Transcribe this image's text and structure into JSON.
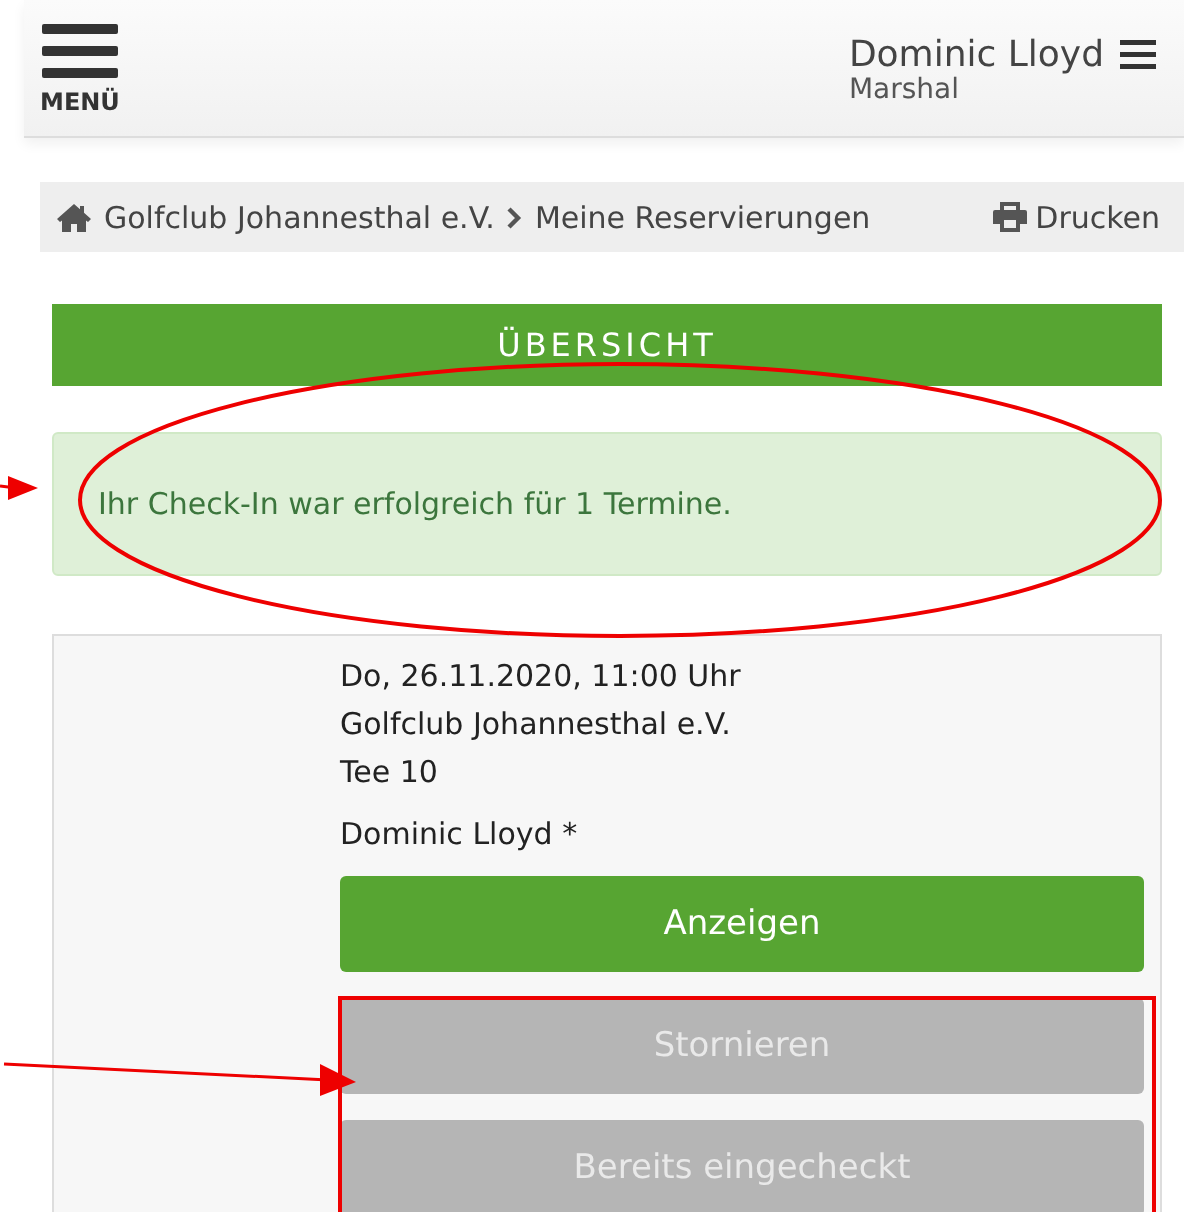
{
  "header": {
    "menu_label": "MENÜ",
    "user_name": "Dominic Lloyd",
    "user_role": "Marshal"
  },
  "breadcrumb": {
    "items": [
      "Golfclub Johannesthal e.V.",
      "Meine Reservierungen"
    ],
    "print_label": "Drucken"
  },
  "section_title": "ÜBERSICHT",
  "alert": {
    "text": "Ihr Check-In war erfolgreich für 1 Termine."
  },
  "reservation": {
    "lines": [
      "Do, 26.11.2020, 11:00 Uhr",
      "Golfclub Johannesthal e.V.",
      "Tee 10"
    ],
    "player": "Dominic Lloyd *",
    "buttons": [
      {
        "label": "Anzeigen",
        "disabled": false
      },
      {
        "label": "Stornieren",
        "disabled": true
      },
      {
        "label": "Bereits eingecheckt",
        "disabled": true
      }
    ]
  },
  "annotations": [
    {
      "kind": "ellipse"
    },
    {
      "kind": "arrow-top"
    },
    {
      "kind": "arrow-bottom"
    },
    {
      "kind": "frame"
    }
  ]
}
